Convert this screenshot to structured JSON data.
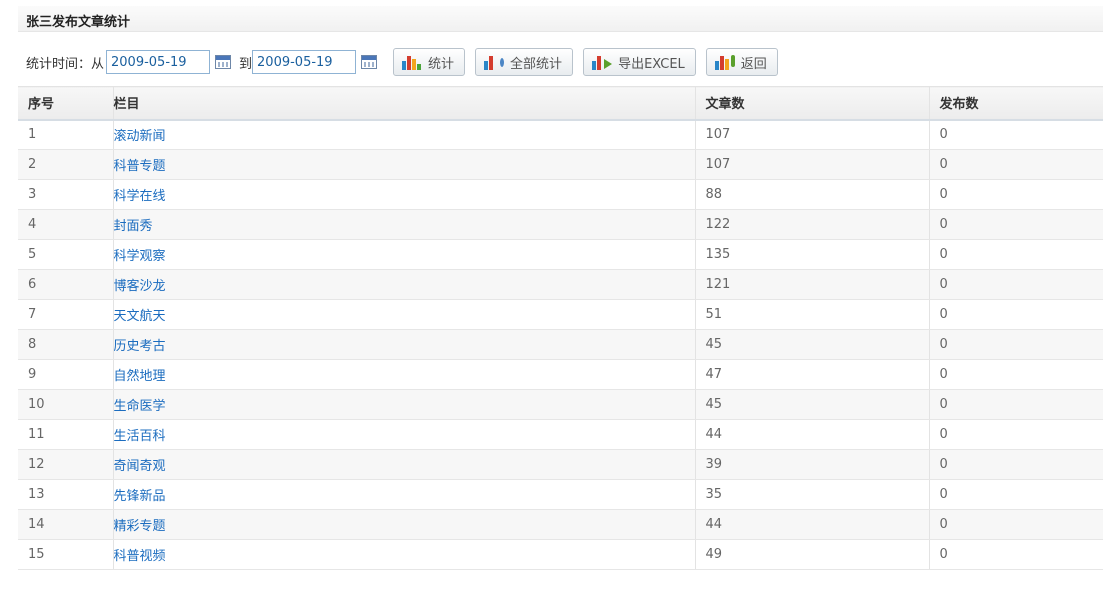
{
  "page": {
    "title": "张三发布文章统计"
  },
  "toolbar": {
    "time_label": "统计时间：从",
    "from_date": "2009-05-19",
    "to_label": "到",
    "to_date": "2009-05-19",
    "stat_button": "统计",
    "all_stat_button": "全部统计",
    "export_button": "导出EXCEL",
    "back_button": "返回"
  },
  "table": {
    "headers": {
      "seq": "序号",
      "column": "栏目",
      "articles": "文章数",
      "published": "发布数"
    },
    "rows": [
      {
        "seq": "1",
        "column": "滚动新闻",
        "articles": "107",
        "published": "0"
      },
      {
        "seq": "2",
        "column": "科普专题",
        "articles": "107",
        "published": "0"
      },
      {
        "seq": "3",
        "column": "科学在线",
        "articles": "88",
        "published": "0"
      },
      {
        "seq": "4",
        "column": "封面秀",
        "articles": "122",
        "published": "0"
      },
      {
        "seq": "5",
        "column": "科学观察",
        "articles": "135",
        "published": "0"
      },
      {
        "seq": "6",
        "column": "博客沙龙",
        "articles": "121",
        "published": "0"
      },
      {
        "seq": "7",
        "column": "天文航天",
        "articles": "51",
        "published": "0"
      },
      {
        "seq": "8",
        "column": "历史考古",
        "articles": "45",
        "published": "0"
      },
      {
        "seq": "9",
        "column": "自然地理",
        "articles": "47",
        "published": "0"
      },
      {
        "seq": "10",
        "column": "生命医学",
        "articles": "45",
        "published": "0"
      },
      {
        "seq": "11",
        "column": "生活百科",
        "articles": "44",
        "published": "0"
      },
      {
        "seq": "12",
        "column": "奇闻奇观",
        "articles": "39",
        "published": "0"
      },
      {
        "seq": "13",
        "column": "先锋新品",
        "articles": "35",
        "published": "0"
      },
      {
        "seq": "14",
        "column": "精彩专题",
        "articles": "44",
        "published": "0"
      },
      {
        "seq": "15",
        "column": "科普视频",
        "articles": "49",
        "published": "0"
      }
    ]
  },
  "colors": {
    "link": "#1b6cbf",
    "row_alt": "#f7f7f7",
    "input_border": "#8fb3d4"
  }
}
